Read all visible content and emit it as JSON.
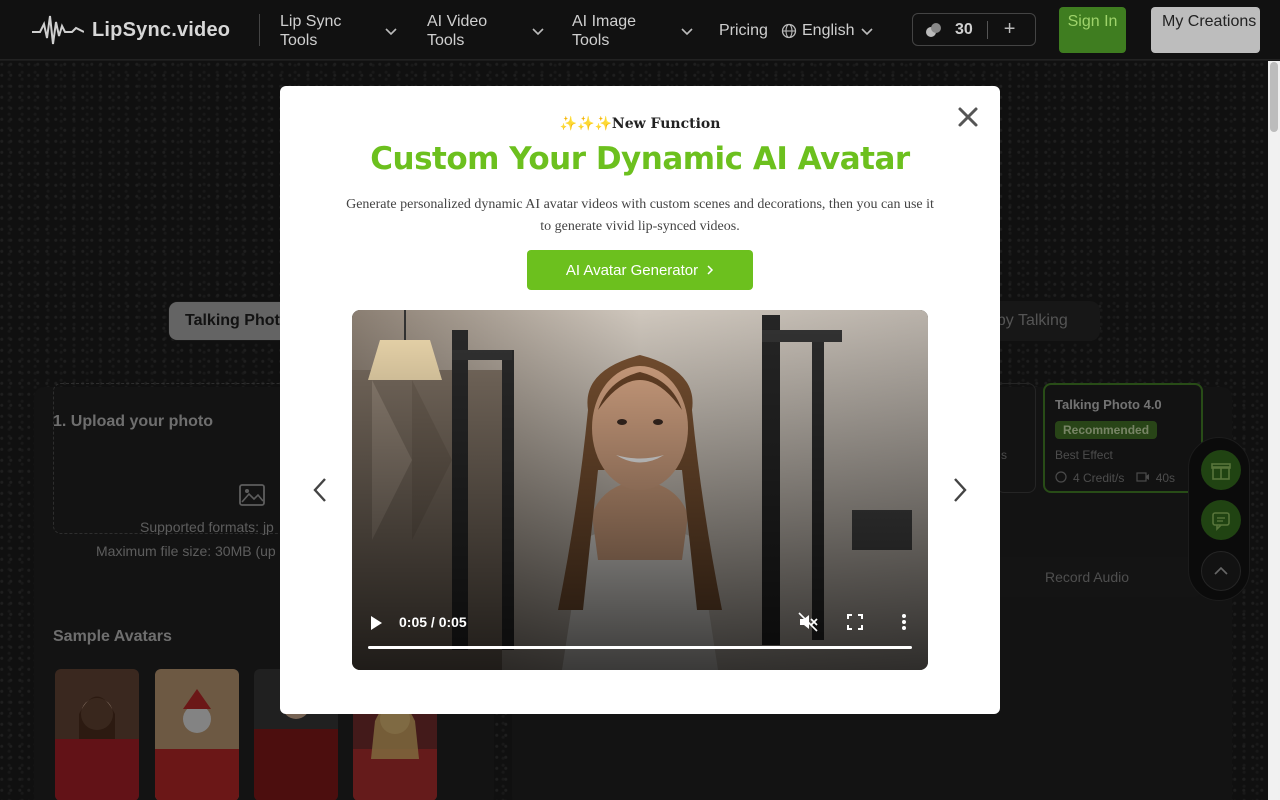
{
  "header": {
    "logo_text": "LipSync.video",
    "nav": [
      {
        "label": "Lip Sync Tools"
      },
      {
        "label": "AI Video Tools"
      },
      {
        "label": "AI Image Tools"
      },
      {
        "label": "Pricing"
      }
    ],
    "language": "English",
    "credits": "30",
    "signin_label": "Sign In",
    "my_creations_label": "My Creations"
  },
  "background": {
    "tab_active": "Talking Phot",
    "tab_right": "aby Talking",
    "upload_title": "1. Upload your photo",
    "upload_formats": "Supported formats: jp",
    "upload_size": "Maximum file size: 30MB (up",
    "sample_title": "Sample Avatars",
    "card": {
      "title": "Talking Photo 4.0",
      "badge": "Recommended",
      "sub": "Best Effect",
      "credits": "4 Credit/s",
      "duration": "40s"
    },
    "prev_card_fragment": "s",
    "record_audio": "Record Audio"
  },
  "modal": {
    "sparkles": "✨✨✨",
    "kicker": "New Function",
    "headline": "Custom Your Dynamic AI Avatar",
    "description": "Generate personalized dynamic AI avatar videos with custom scenes and decorations, then you can use it to generate vivid lip-synced videos.",
    "cta_label": "AI Avatar Generator",
    "video": {
      "time": "0:05 / 0:05",
      "progress": 1.0
    }
  },
  "colors": {
    "accent": "#6cc01e",
    "signin_bg": "#3f7d20"
  }
}
